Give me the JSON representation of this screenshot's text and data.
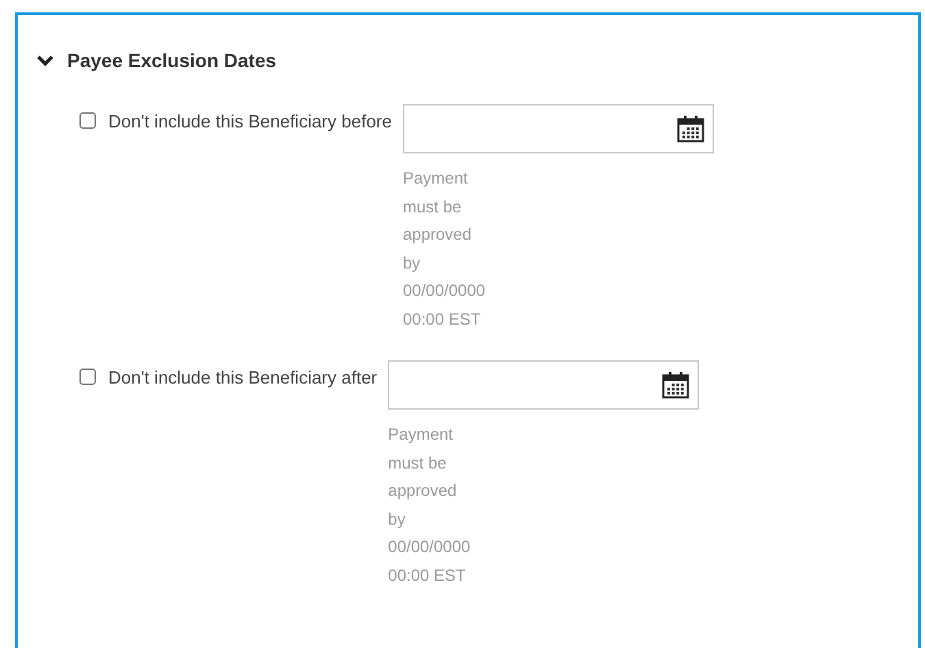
{
  "section": {
    "title": "Payee Exclusion Dates",
    "expanded": true,
    "rows": [
      {
        "label": "Don't include this Beneficiary before",
        "checked": false,
        "hint": "Payment must be approved by 00/00/0000 00:00 EST"
      },
      {
        "label": "Don't include this Beneficiary after",
        "checked": false,
        "hint": "Payment must be approved by 00/00/0000 00:00 EST"
      }
    ]
  }
}
